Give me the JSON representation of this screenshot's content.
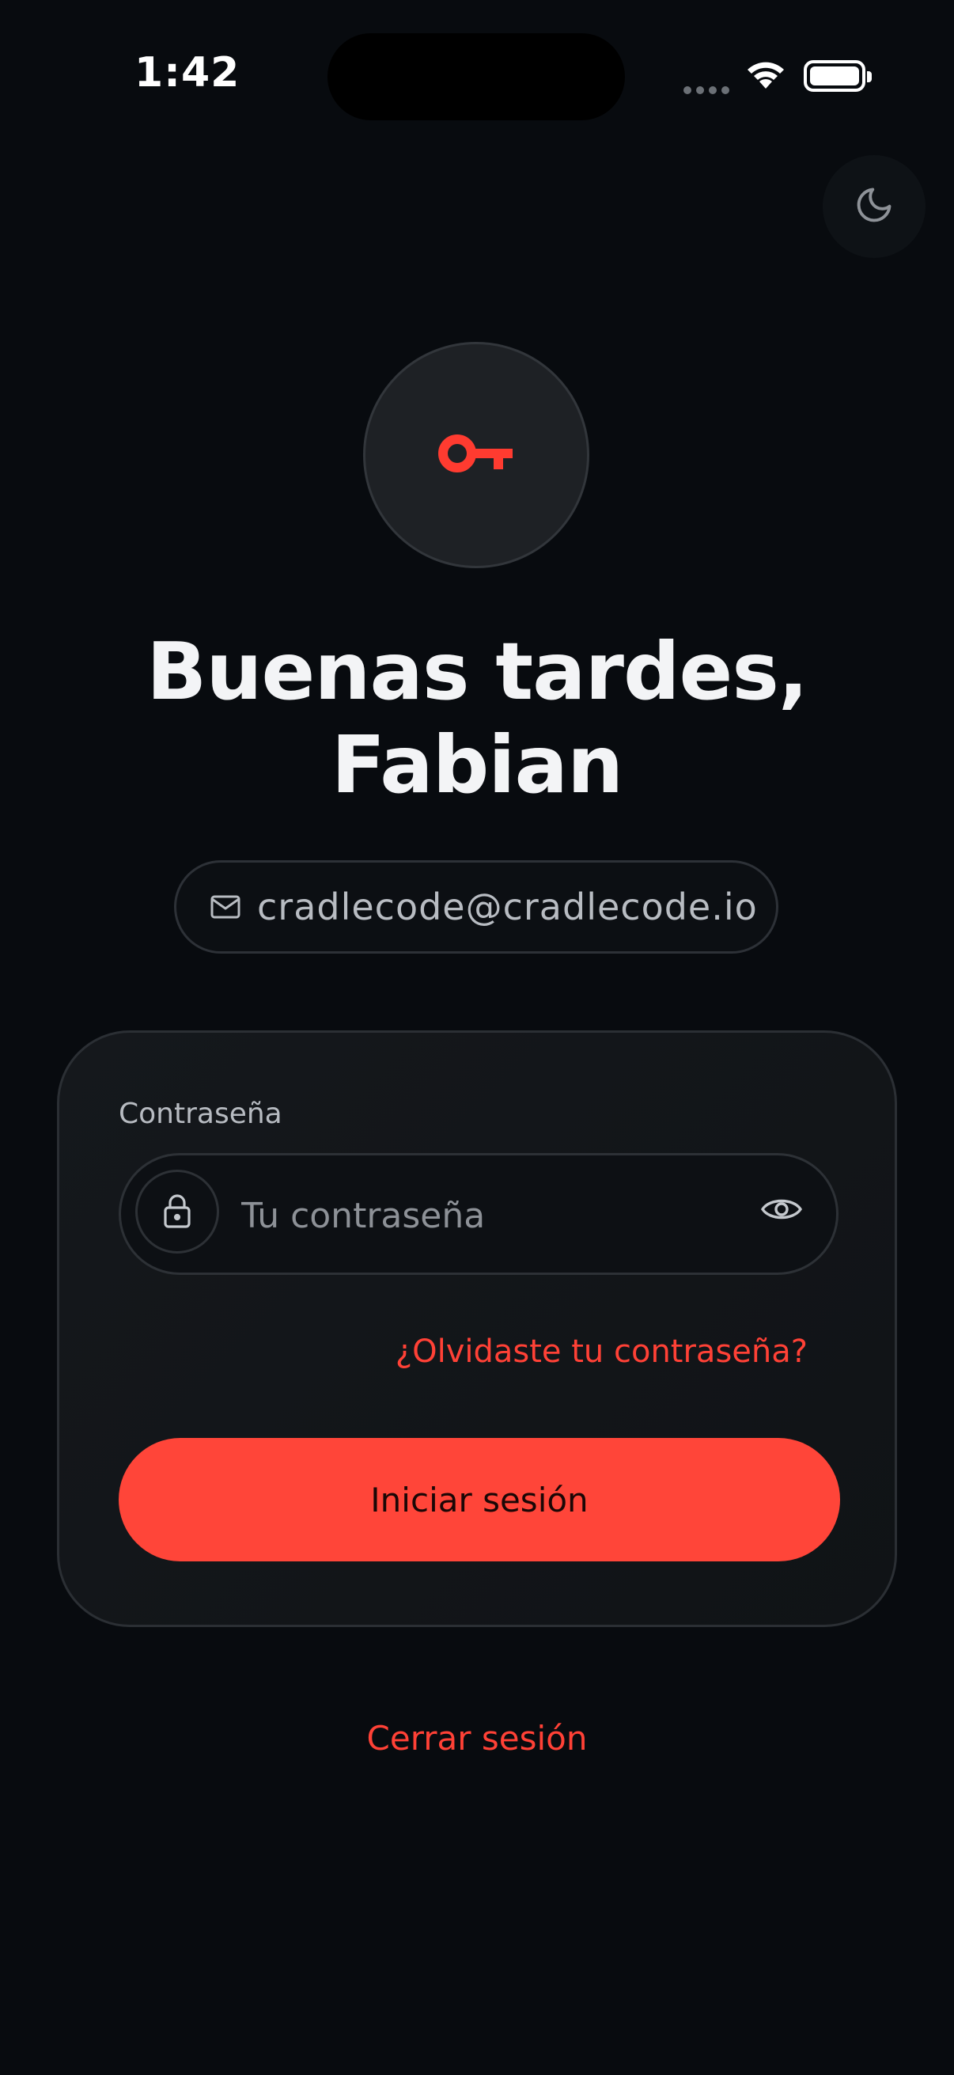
{
  "status_bar": {
    "time": "1:42"
  },
  "theme_toggle": {
    "icon": "moon-icon"
  },
  "hero": {
    "icon": "key-icon",
    "accent": "#ff3b30"
  },
  "greeting": {
    "line1": "Buenas tardes,",
    "line2": "Fabian"
  },
  "account": {
    "icon": "mail-icon",
    "email": "cradlecode@cradlecode.io"
  },
  "form": {
    "password_label": "Contraseña",
    "password_placeholder": "Tu contraseña",
    "password_value": "",
    "lock_icon": "lock-icon",
    "toggle_icon": "eye-icon",
    "forgot_link": "¿Olvidaste tu contraseña?",
    "submit_label": "Iniciar sesión"
  },
  "logout_label": "Cerrar sesión",
  "colors": {
    "background": "#080b0f",
    "accent": "#ff4539",
    "link": "#ff4136"
  }
}
